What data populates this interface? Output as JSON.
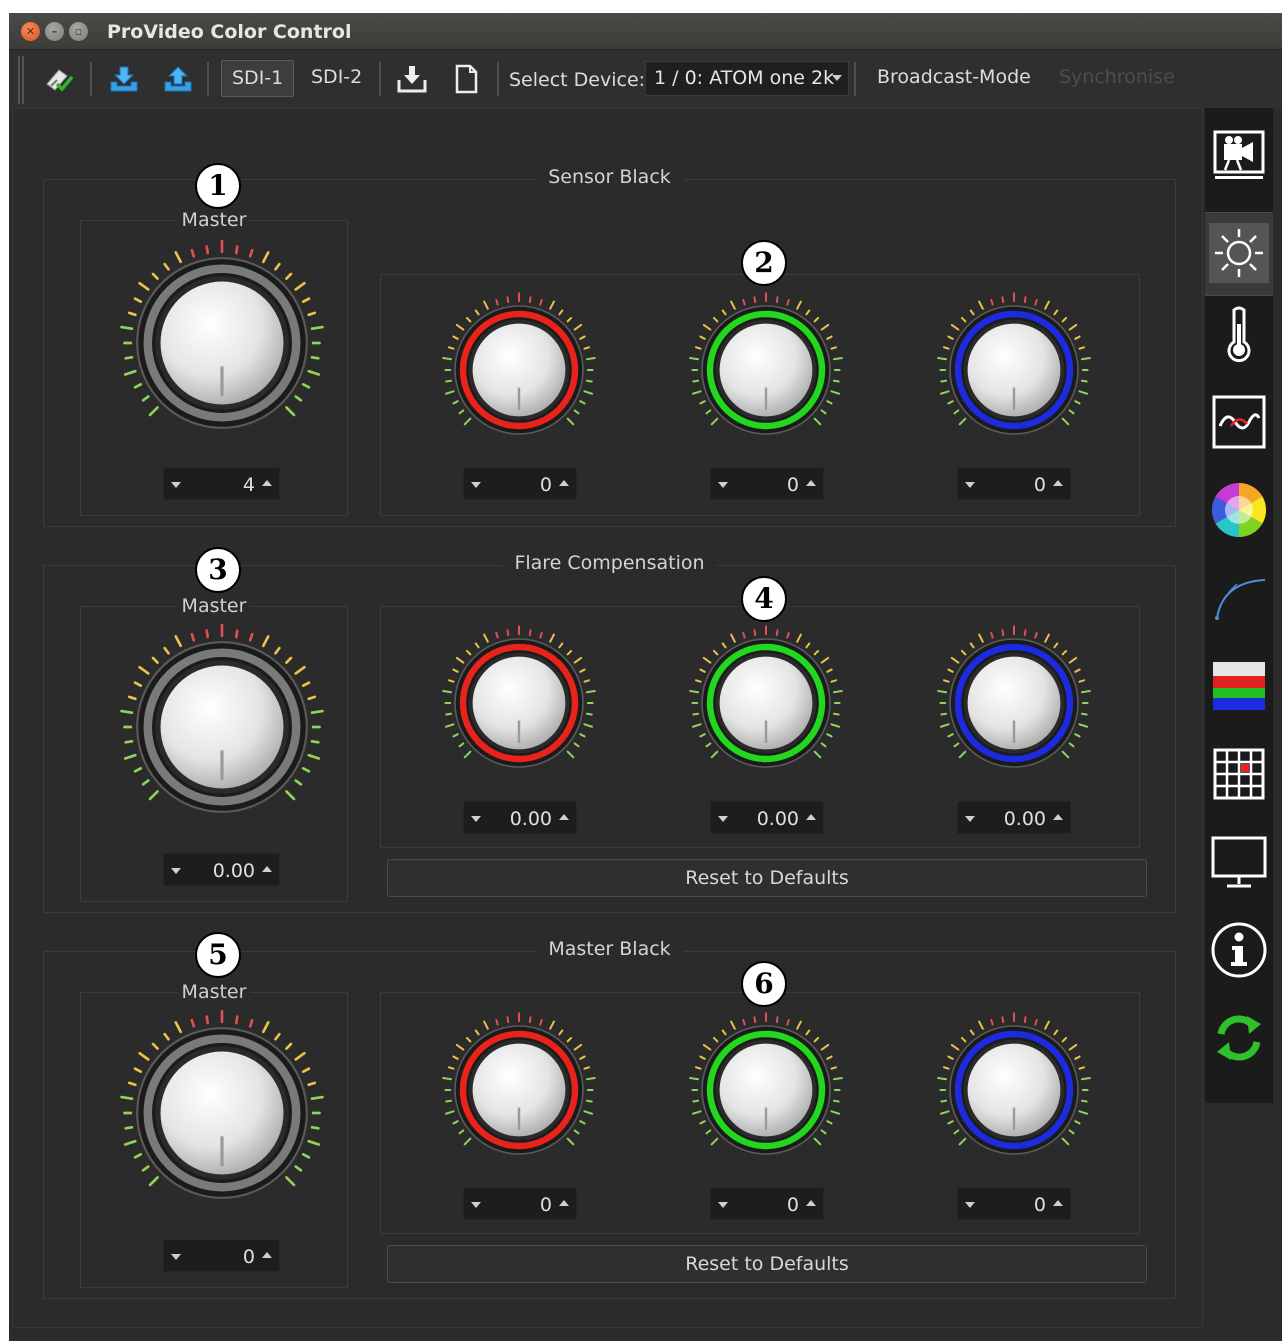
{
  "window": {
    "title": "ProVideo Color Control"
  },
  "toolbar": {
    "tabs": [
      "SDI-1",
      "SDI-2"
    ],
    "active_tab": "SDI-1",
    "select_label": "Select Device:",
    "device": "1 / 0: ATOM one 2k",
    "broadcast_label": "Broadcast-Mode",
    "sync_label": "Synchronise",
    "icons": [
      "eraser-check-icon",
      "download-blue-icon",
      "upload-blue-icon",
      "save-to-device-icon",
      "new-file-icon"
    ]
  },
  "sections": [
    {
      "title": "Sensor Black",
      "master_label": "Master",
      "master_value": "4",
      "rgb_values": [
        "0",
        "0",
        "0"
      ],
      "reset_label": ""
    },
    {
      "title": "Flare Compensation",
      "master_label": "Master",
      "master_value": "0.00",
      "rgb_values": [
        "0.00",
        "0.00",
        "0.00"
      ],
      "reset_label": "Reset to Defaults"
    },
    {
      "title": "Master Black",
      "master_label": "Master",
      "master_value": "0",
      "rgb_values": [
        "0",
        "0",
        "0"
      ],
      "reset_label": "Reset to Defaults"
    }
  ],
  "callouts": [
    "1",
    "2",
    "3",
    "4",
    "5",
    "6"
  ],
  "colors": {
    "red": "#e8231c",
    "green": "#22d81e",
    "blue": "#1c2be0",
    "background": "#2b2b2b"
  },
  "sidebar": {
    "items": [
      "camera-icon",
      "brightness-icon",
      "thermometer-icon",
      "waveform-icon",
      "color-wheel-icon",
      "curve-icon",
      "rgb-bars-icon",
      "grid-icon",
      "monitor-icon",
      "info-icon",
      "refresh-icon"
    ],
    "active": "brightness-icon"
  }
}
